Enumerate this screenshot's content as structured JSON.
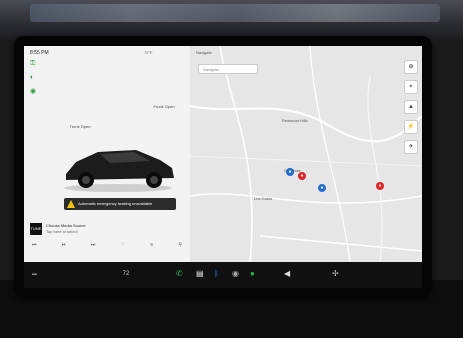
{
  "status": {
    "time": "8:55 PM",
    "right": "72°F"
  },
  "left_panel": {
    "callout_left": "Trunk Open",
    "callout_right": "Frunk Open",
    "warning": "Automatic emergency braking unavailable",
    "media_art": "TUNE",
    "media_title": "Choose Media Source",
    "media_sub": "Tap here to select",
    "media_controls": [
      "⏮",
      "⏯",
      "⏭",
      "♡",
      "≡",
      "⚲"
    ]
  },
  "map": {
    "top_text": "Navigate",
    "search_placeholder": "Navigate",
    "controls": [
      "⊕",
      "⌖",
      "▲",
      "⚡",
      "✈"
    ],
    "labels": [
      "Redwood Hills",
      "San Jose",
      "Los Gatos"
    ]
  },
  "taskbar": {
    "temp": "72",
    "icons": [
      "phone-icon",
      "app-icon",
      "bluetooth-icon",
      "camera-icon",
      "spotify-icon",
      "volume-icon"
    ]
  },
  "colors": {
    "accent_green": "#2a9d3a",
    "taskbar": "#101010",
    "map_bg": "#e6e6e6"
  }
}
